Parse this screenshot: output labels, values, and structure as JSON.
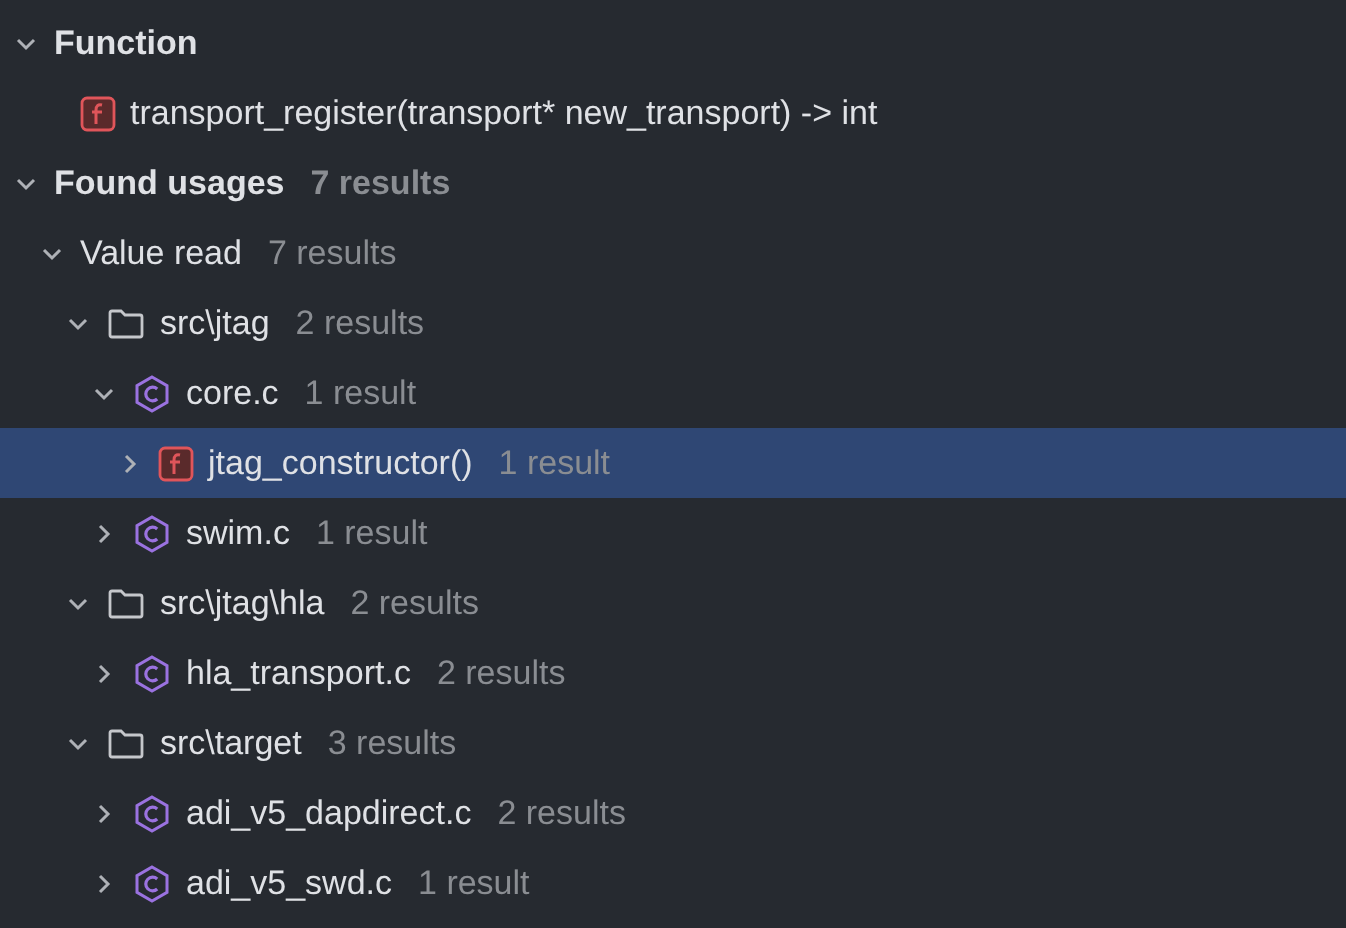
{
  "tree": [
    {
      "kind": "group",
      "label": "Function",
      "expanded": true,
      "selected": false,
      "children": [
        {
          "kind": "function",
          "label": "transport_register(transport* new_transport) -> int",
          "selected": false
        }
      ]
    },
    {
      "kind": "group",
      "label": "Found usages",
      "count": "7 results",
      "expanded": true,
      "selected": false,
      "children": [
        {
          "kind": "category",
          "label": "Value read",
          "count": "7 results",
          "expanded": true,
          "selected": false,
          "children": [
            {
              "kind": "folder",
              "label": "src\\jtag",
              "count": "2 results",
              "expanded": true,
              "selected": false,
              "children": [
                {
                  "kind": "file",
                  "label": "core.c",
                  "count": "1 result",
                  "expanded": true,
                  "selected": false,
                  "children": [
                    {
                      "kind": "function",
                      "label": "jtag_constructor()",
                      "count": "1 result",
                      "expanded": false,
                      "selected": true
                    }
                  ]
                },
                {
                  "kind": "file",
                  "label": "swim.c",
                  "count": "1 result",
                  "expanded": false,
                  "selected": false
                }
              ]
            },
            {
              "kind": "folder",
              "label": "src\\jtag\\hla",
              "count": "2 results",
              "expanded": true,
              "selected": false,
              "children": [
                {
                  "kind": "file",
                  "label": "hla_transport.c",
                  "count": "2 results",
                  "expanded": false,
                  "selected": false
                }
              ]
            },
            {
              "kind": "folder",
              "label": "src\\target",
              "count": "3 results",
              "expanded": true,
              "selected": false,
              "children": [
                {
                  "kind": "file",
                  "label": "adi_v5_dapdirect.c",
                  "count": "2 results",
                  "expanded": false,
                  "selected": false
                },
                {
                  "kind": "file",
                  "label": "adi_v5_swd.c",
                  "count": "1 result",
                  "expanded": false,
                  "selected": false
                }
              ]
            }
          ]
        }
      ]
    }
  ]
}
